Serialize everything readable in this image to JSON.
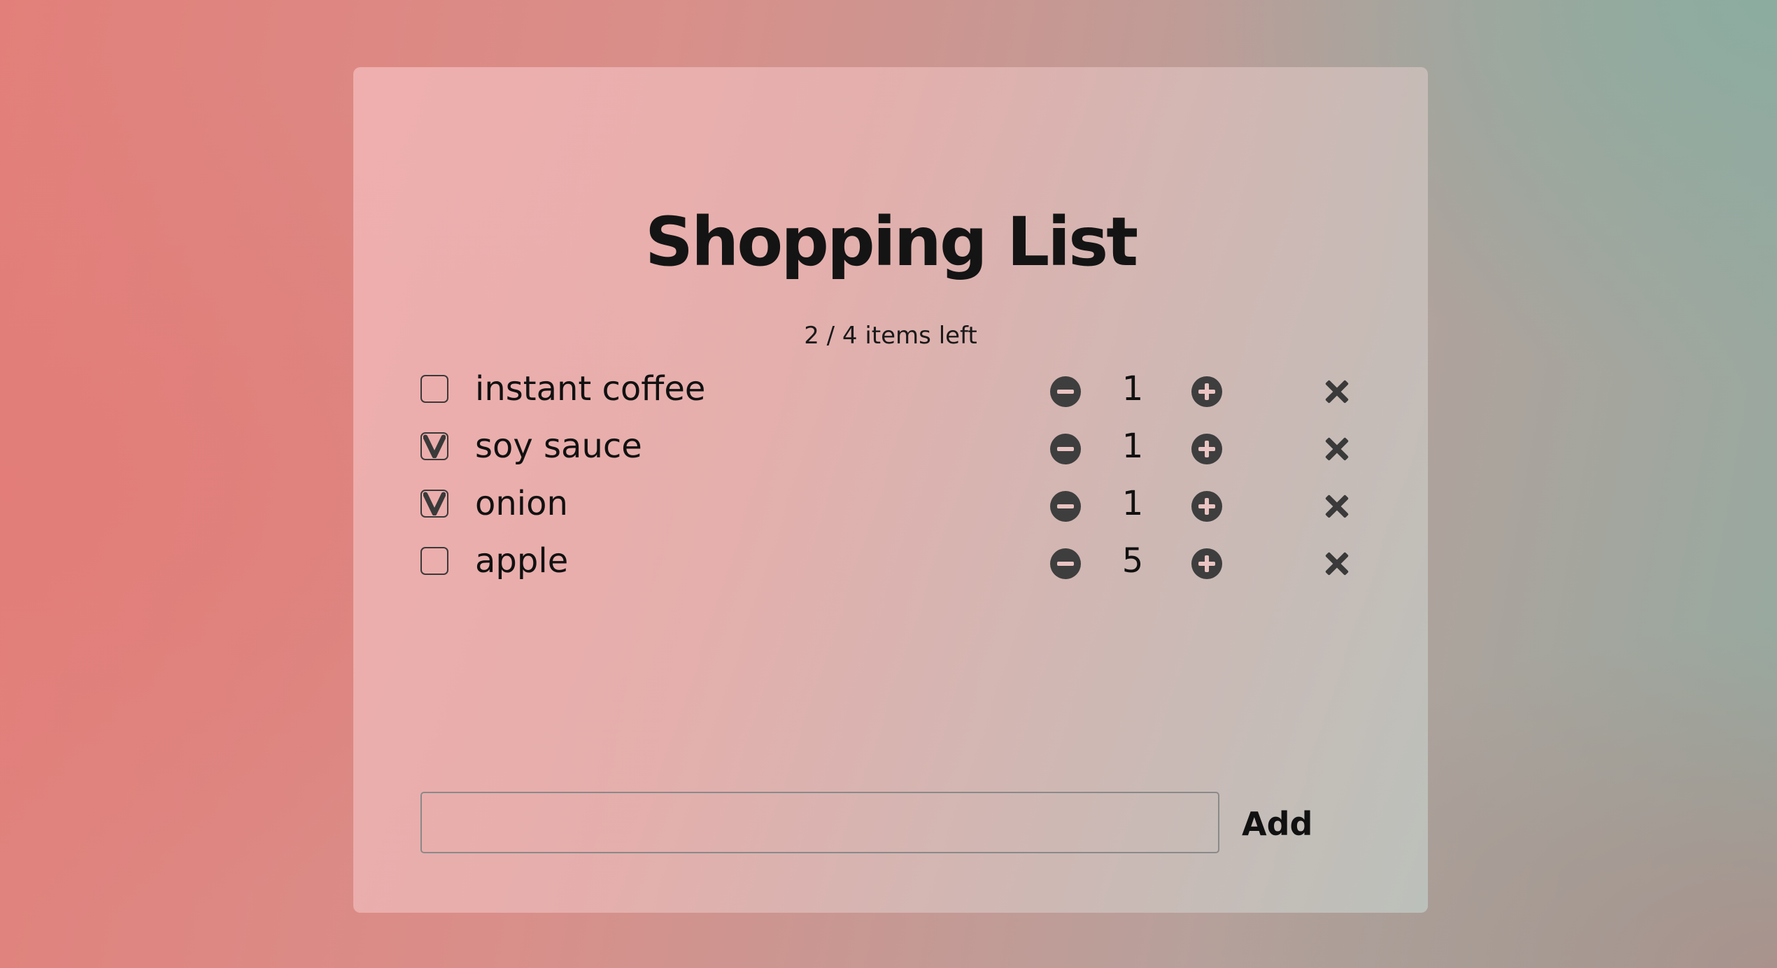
{
  "title": "Shopping List",
  "counter_text": "2 / 4 items left",
  "items": [
    {
      "name": "instant coffee",
      "quantity": "1",
      "checked": false
    },
    {
      "name": "soy sauce",
      "quantity": "1",
      "checked": true
    },
    {
      "name": "onion",
      "quantity": "1",
      "checked": true
    },
    {
      "name": "apple",
      "quantity": "5",
      "checked": false
    }
  ],
  "add_form": {
    "input_value": "",
    "placeholder": "",
    "button_label": "Add"
  },
  "icons": {
    "decrement": "minus-circle-icon",
    "increment": "plus-circle-icon",
    "remove": "close-icon",
    "check": "checkmark-icon"
  },
  "colors": {
    "icon": "#3e3e3e",
    "text": "#111111"
  }
}
